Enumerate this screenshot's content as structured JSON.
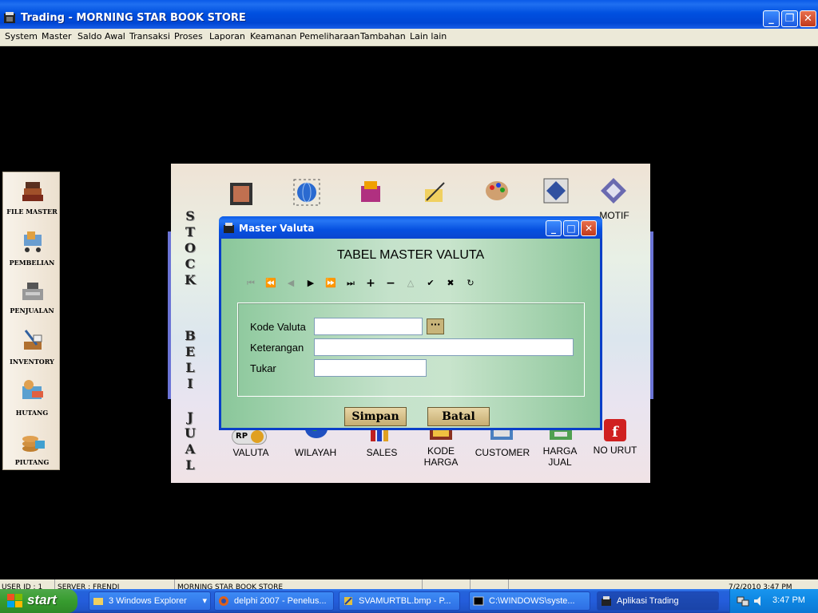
{
  "window": {
    "title": "Trading - MORNING STAR BOOK STORE",
    "minimize": "_",
    "maximize": "❐",
    "close": "✕"
  },
  "menu": [
    "System",
    "Master",
    "Saldo Awal",
    "Transaksi",
    "Proses",
    "Laporan",
    "Keamanan",
    "Pemeliharaan",
    "Tambahan",
    "Lain lain"
  ],
  "left_toolbar": [
    "FILE MASTER",
    "PEMBELIAN",
    "PENJUALAN",
    "INVENTORY",
    "HUTANG",
    "PIUTANG"
  ],
  "panel": {
    "section_stock": [
      "S",
      "T",
      "O",
      "C",
      "K"
    ],
    "section_beli": [
      "B",
      "E",
      "L",
      "I"
    ],
    "section_jual": [
      "J",
      "U",
      "A",
      "L"
    ],
    "top_icons_label_motif": "MOTIF",
    "bottom_items": [
      "VALUTA",
      "WILAYAH",
      "SALES",
      "KODE\nHARGA",
      "CUSTOMER",
      "HARGA\nJUAL",
      "NO URUT"
    ],
    "valuta_badge": "RP"
  },
  "dialog": {
    "title": "Master Valuta",
    "heading": "TABEL MASTER VALUTA",
    "nav": [
      "first",
      "prior-page",
      "prior",
      "next",
      "next-page",
      "last",
      "insert",
      "delete",
      "edit",
      "post",
      "cancel",
      "refresh"
    ],
    "fields": {
      "kode_valuta": {
        "label": "Kode Valuta",
        "value": ""
      },
      "keterangan": {
        "label": "Keterangan",
        "value": ""
      },
      "tukar": {
        "label": "Tukar",
        "value": ""
      }
    },
    "lookup_label": "···",
    "buttons": {
      "save": "Simpan",
      "cancel": "Batal"
    }
  },
  "statusbar": [
    "USER ID : 1",
    "SERVER : FRENDI",
    "MORNING STAR BOOK STORE",
    "",
    "",
    "7/2/2010 3:47 PM"
  ],
  "taskbar": {
    "start": "start",
    "tasks": [
      "3 Windows Explorer",
      "delphi 2007 - Penelus...",
      "SVAMURTBL.bmp - P...",
      "C:\\WINDOWS\\syste...",
      "Aplikasi Trading"
    ],
    "clock": "3:47 PM"
  }
}
